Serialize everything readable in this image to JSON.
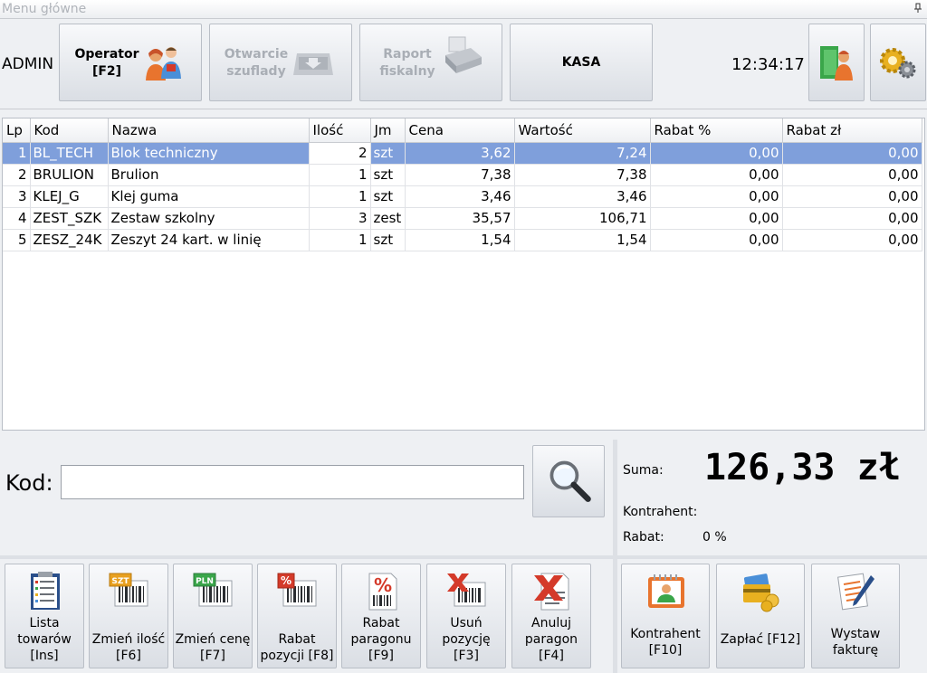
{
  "window": {
    "title": "Menu główne",
    "pin_icon": "pin-icon"
  },
  "toolbar": {
    "user": "ADMIN",
    "operator_label": "Operator\n[F2]",
    "drawer_label": "Otwarcie\nszuflady",
    "report_label": "Raport\nfiskalny",
    "kasa_label": "KASA",
    "clock": "12:34:17"
  },
  "table": {
    "columns": [
      "Lp",
      "Kod",
      "Nazwa",
      "Ilość",
      "Jm",
      "Cena",
      "Wartość",
      "Rabat %",
      "Rabat zł"
    ],
    "rows": [
      {
        "lp": "1",
        "kod": "BL_TECH",
        "nazwa": "Blok techniczny",
        "ilosc": "2",
        "jm": "szt",
        "cena": "3,62",
        "wartosc": "7,24",
        "rabat_pct": "0,00",
        "rabat_zl": "0,00"
      },
      {
        "lp": "2",
        "kod": "BRULION",
        "nazwa": "Brulion",
        "ilosc": "1",
        "jm": "szt",
        "cena": "7,38",
        "wartosc": "7,38",
        "rabat_pct": "0,00",
        "rabat_zl": "0,00"
      },
      {
        "lp": "3",
        "kod": "KLEJ_G",
        "nazwa": "Klej guma",
        "ilosc": "1",
        "jm": "szt",
        "cena": "3,46",
        "wartosc": "3,46",
        "rabat_pct": "0,00",
        "rabat_zl": "0,00"
      },
      {
        "lp": "4",
        "kod": "ZEST_SZK",
        "nazwa": "Zestaw szkolny",
        "ilosc": "3",
        "jm": "zest",
        "cena": "35,57",
        "wartosc": "106,71",
        "rabat_pct": "0,00",
        "rabat_zl": "0,00"
      },
      {
        "lp": "5",
        "kod": "ZESZ_24K",
        "nazwa": "Zeszyt 24 kart. w linię",
        "ilosc": "1",
        "jm": "szt",
        "cena": "1,54",
        "wartosc": "1,54",
        "rabat_pct": "0,00",
        "rabat_zl": "0,00"
      }
    ]
  },
  "kod": {
    "label": "Kod:",
    "value": "",
    "placeholder": ""
  },
  "summary": {
    "suma_label": "Suma:",
    "suma_value": "126,33 zł",
    "kontrahent_label": "Kontrahent:",
    "rabat_label": "Rabat:",
    "rabat_value": "0 %"
  },
  "actions": {
    "lista": "Lista\ntowarów\n[Ins]",
    "zmien_ilosc": "Zmień ilość\n[F6]",
    "zmien_cene": "Zmień cenę\n[F7]",
    "rabat_pozycji": "Rabat\npozycji [F8]",
    "rabat_paragonu": "Rabat\nparagonu\n[F9]",
    "usun_pozycje": "Usuń\npozycję\n[F3]",
    "anuluj_paragon": "Anuluj\nparagon\n[F4]",
    "kontrahent": "Kontrahent\n[F10]",
    "zaplac": "Zapłać [F12]",
    "wystaw_fakture": "Wystaw\nfakturę",
    "szt_badge": "SZT",
    "pln_badge": "PLN",
    "pct_badge": "%"
  },
  "colors": {
    "selection": "#7f9fdb",
    "disabled_text": "#a9aeb5"
  }
}
